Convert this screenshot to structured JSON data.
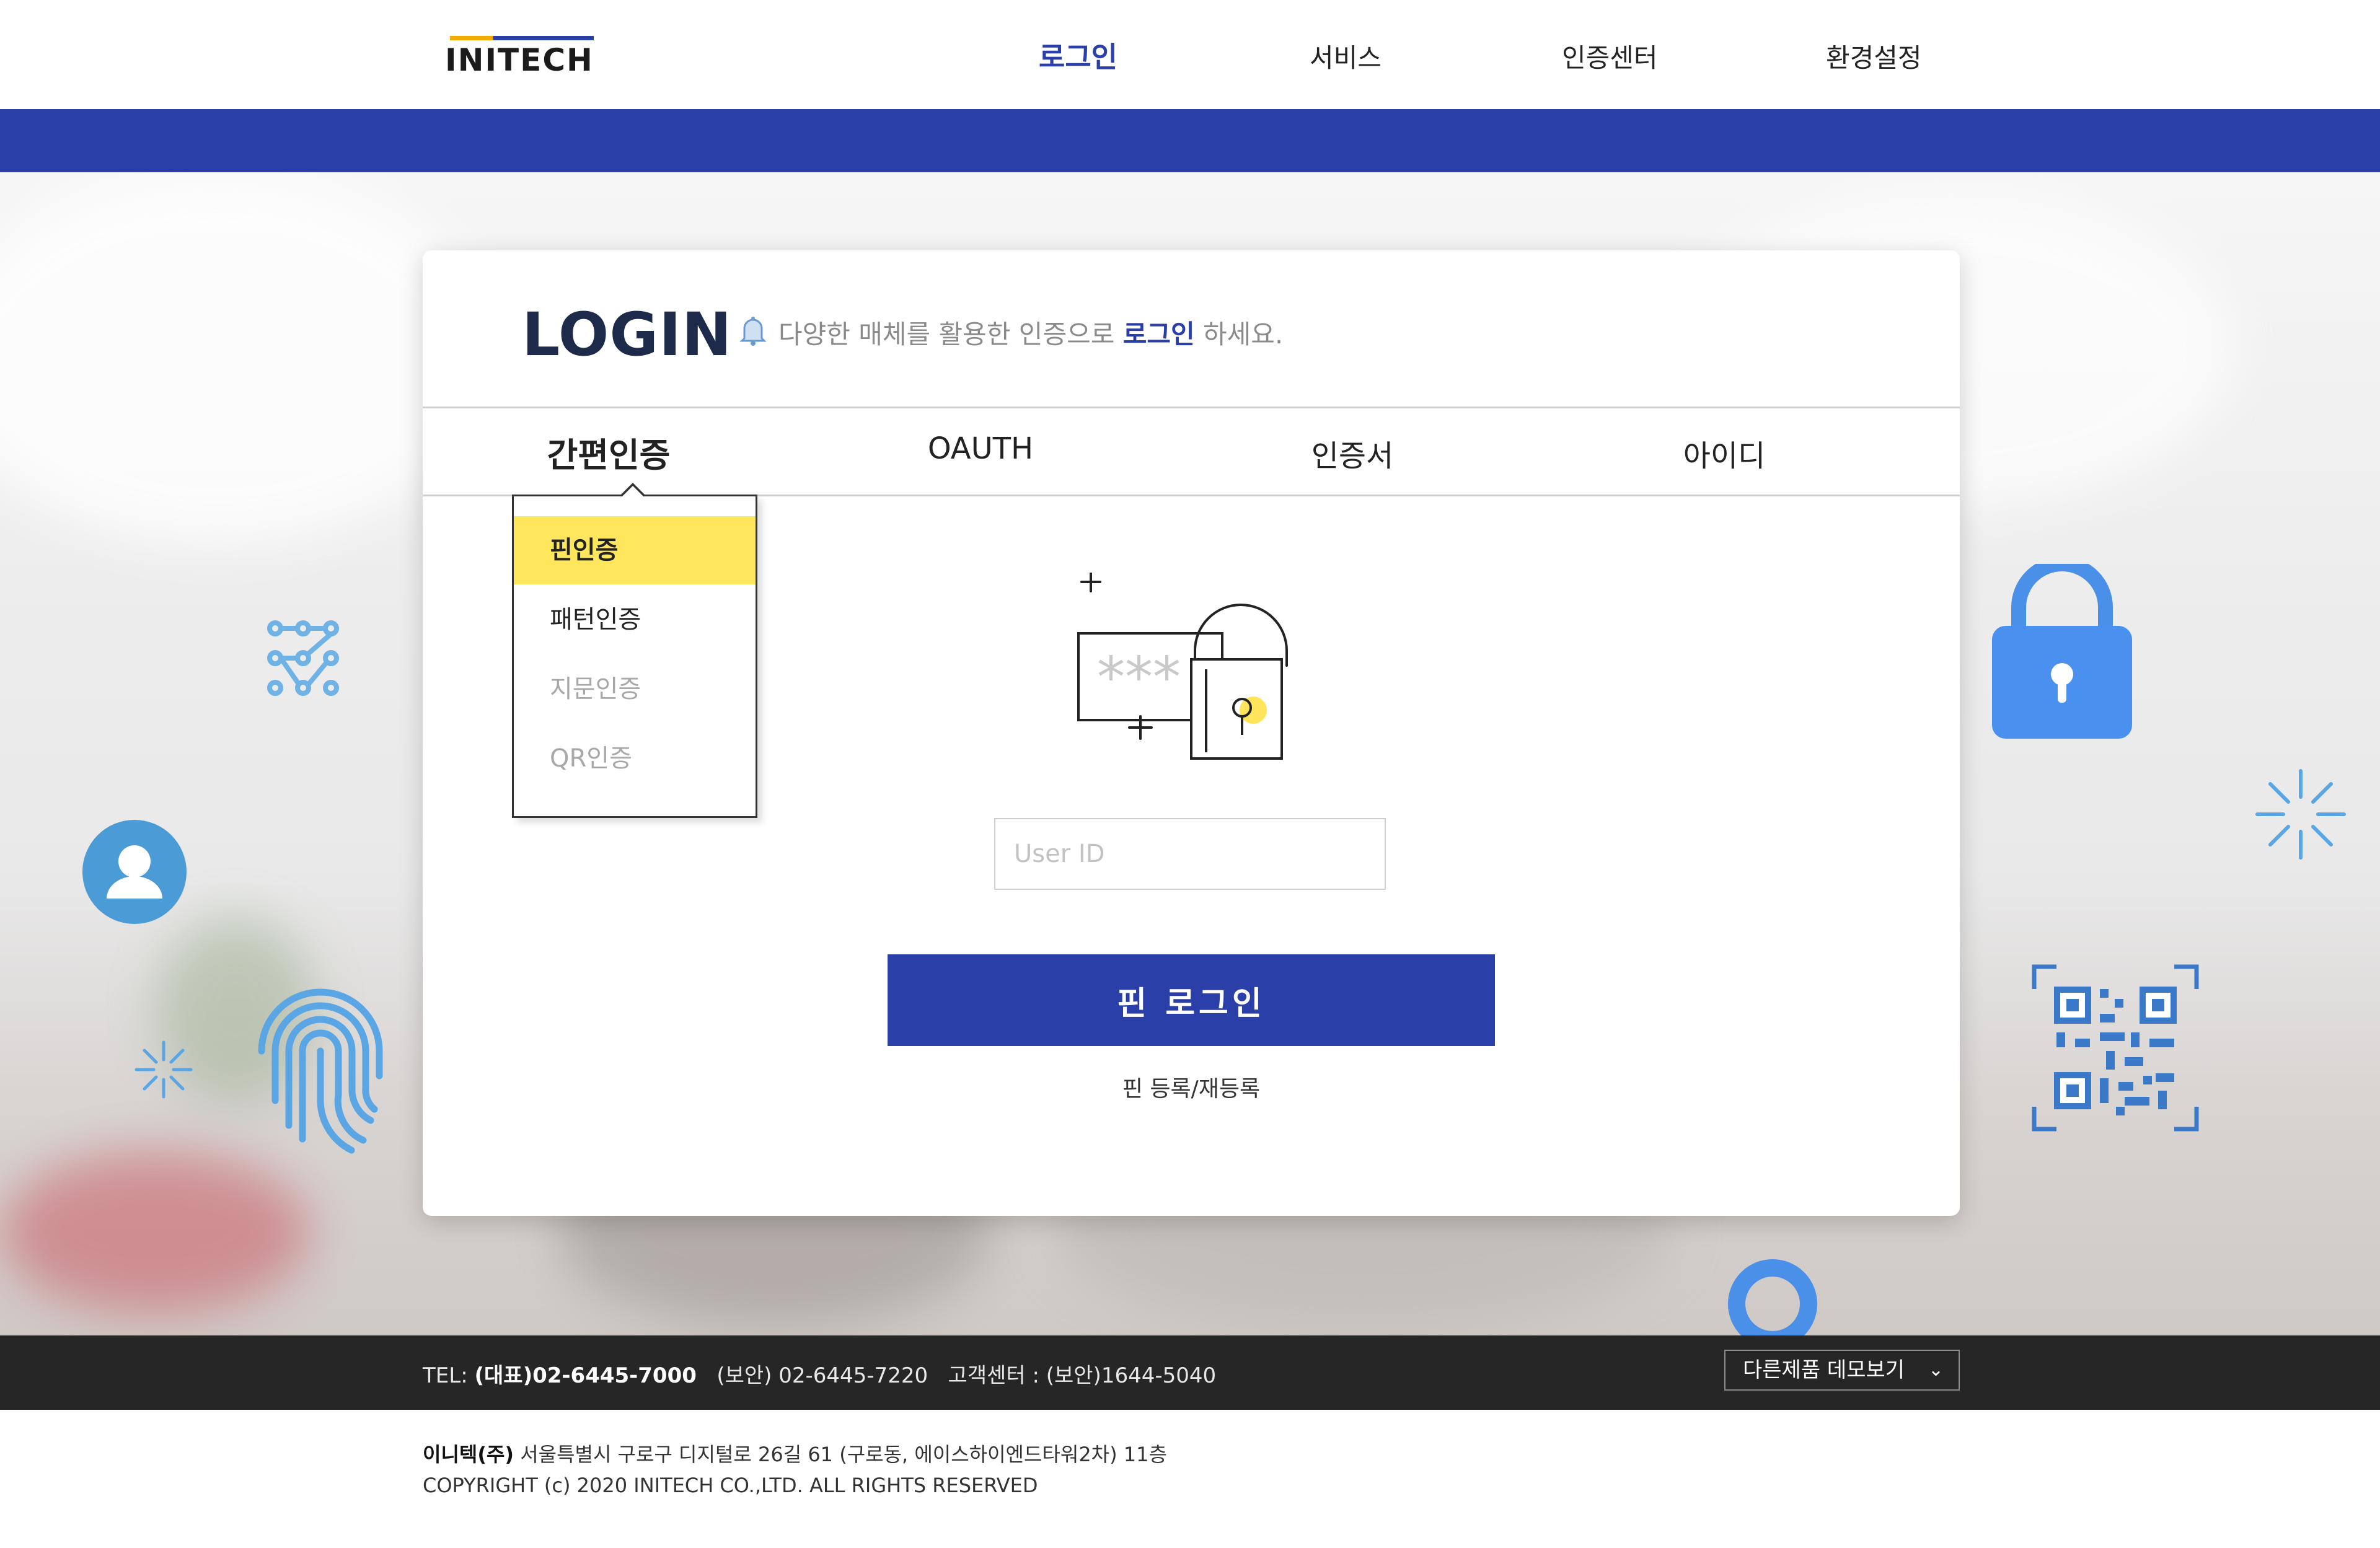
{
  "header": {
    "logo_text": "INITECH",
    "nav": [
      "로그인",
      "서비스",
      "인증센터",
      "환경설정"
    ]
  },
  "colors": {
    "primary": "#2b3fa8",
    "highlight": "#ffe75d",
    "footer_bg": "#262626",
    "icon_blue": "#4a90e2"
  },
  "login": {
    "title": "LOGIN",
    "subtitle_pre": "다양한 매체를 활용한 인증으로 ",
    "subtitle_hl": "로그인",
    "subtitle_post": " 하세요.",
    "tabs": [
      "간편인증",
      "OAUTH",
      "인증서",
      "아이디"
    ],
    "dropdown": [
      "핀인증",
      "패턴인증",
      "지문인증",
      "QR인증"
    ],
    "userid_placeholder": "User ID",
    "pin_login_button": "핀 로그인",
    "pin_register_link": "핀 등록/재등록"
  },
  "footer": {
    "tel_label": "TEL: ",
    "tel_main": "(대표)02-6445-7000",
    "tel_security": "(보안) 02-6445-7220",
    "customer_center": "고객센터 : (보안)1644-5040",
    "demo_button": "다른제품 데모보기",
    "company": "이니텍(주)",
    "address": "서울특별시 구로구 디지털로 26길 61 (구로동, 에이스하이엔드타워2차) 11층",
    "copyright": "COPYRIGHT (c) 2020 INITECH CO.,LTD. ALL RIGHTS RESERVED"
  }
}
